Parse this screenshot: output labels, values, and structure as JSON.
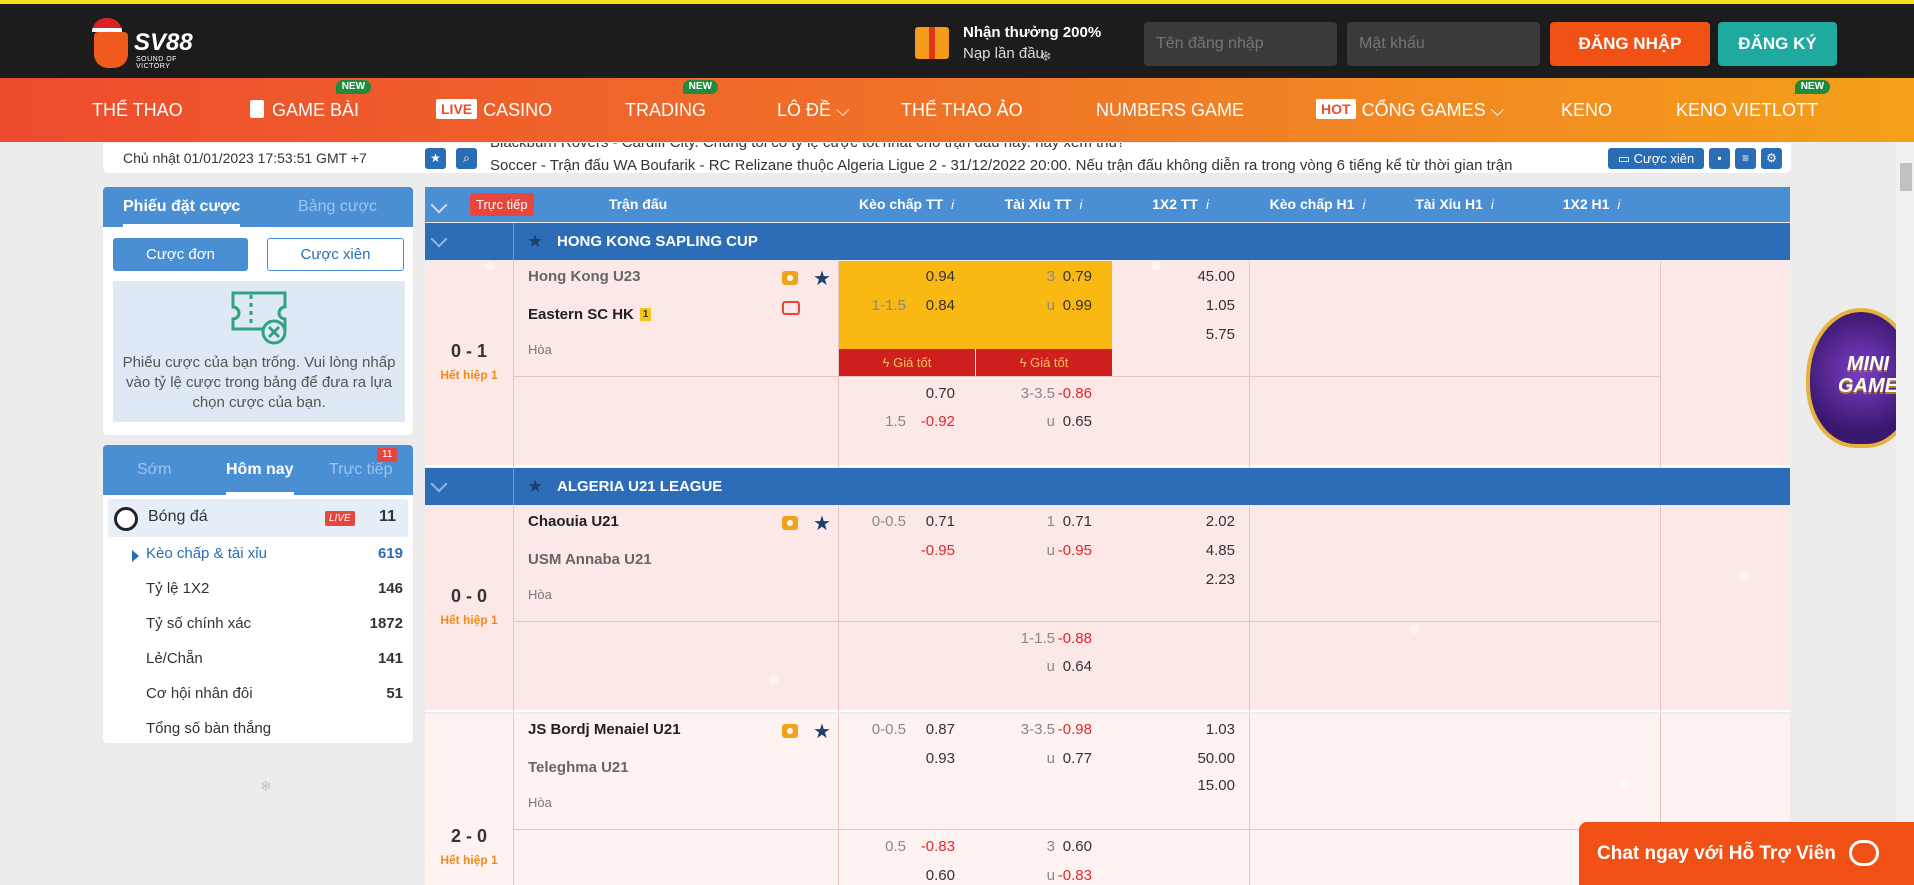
{
  "header": {
    "logo_text": "SV88",
    "logo_sub": "SOUND OF VICTORY",
    "promo_title": "Nhận thưởng 200%",
    "promo_sub": "Nạp lần đầu",
    "username_placeholder": "Tên đăng nhập",
    "password_placeholder": "Mật khẩu",
    "login_label": "ĐĂNG NHẬP",
    "register_label": "ĐĂNG KÝ"
  },
  "nav": [
    {
      "label": "THỂ THAO"
    },
    {
      "label": "GAME BÀI",
      "badge": "NEW"
    },
    {
      "tag": "LIVE",
      "label": "CASINO"
    },
    {
      "label": "TRADING",
      "badge": "NEW"
    },
    {
      "label": "LÔ ĐỀ"
    },
    {
      "label": "THỂ THAO ẢO"
    },
    {
      "label": "NUMBERS GAME"
    },
    {
      "tag": "HOT",
      "label": "CỔNG GAMES"
    },
    {
      "label": "KENO"
    },
    {
      "label": "KENO VIETLOTT",
      "badge": "NEW"
    }
  ],
  "ticker": {
    "clock": "Chủ nhật 01/01/2023 17:53:51 GMT +7",
    "line1": "Blackburn Rovers - Cardiff City. Chúng tôi có tỷ lệ cược tốt nhất cho trận đấu này. hãy xem thử!",
    "line2": "Soccer - Trận đấu WA Boufarik - RC Relizane thuộc Algeria Ligue 2 - 31/12/2022 20:00. Nếu trận đấu không diễn ra trong vòng 6 tiếng kể từ thời gian trận",
    "parlay_label": "Cược xiên"
  },
  "betslip": {
    "tab_active": "Phiếu đặt cược",
    "tab_other": "Bảng cược",
    "single_label": "Cược đơn",
    "parlay_label": "Cược xiên",
    "empty_text": "Phiếu cược của bạn trống. Vui lòng nhấp vào tỷ lệ cược trong bảng để đưa ra lựa chọn cược của bạn."
  },
  "sports": {
    "tabs": [
      "Sớm",
      "Hôm nay",
      "Trực tiếp"
    ],
    "live_count": "11",
    "sport_name": "Bóng đá",
    "live_tag": "LIVE",
    "sport_count": "11",
    "markets": [
      {
        "label": "Kèo chấp & tài xỉu",
        "count": "619"
      },
      {
        "label": "Tỷ lệ 1X2",
        "count": "146"
      },
      {
        "label": "Tỷ số chính xác",
        "count": "1872"
      },
      {
        "label": "Lẻ/Chẵn",
        "count": "141"
      },
      {
        "label": "Cơ hội nhân đôi",
        "count": "51"
      },
      {
        "label": "Tổng số bàn thắng",
        "count": ""
      }
    ]
  },
  "board": {
    "live_tag": "Trực tiếp",
    "columns": [
      "Trận đấu",
      "Kèo chấp TT",
      "Tài Xỉu TT",
      "1X2 TT",
      "Kèo chấp H1",
      "Tài Xỉu H1",
      "1X2 H1"
    ],
    "good_price": "Giá tốt",
    "draw_label": "Hòa",
    "leagues": [
      "HONG KONG SAPLING CUP",
      "ALGERIA U21 LEAGUE"
    ],
    "matches": [
      {
        "score": "0 - 1",
        "status": "Hết hiệp 1",
        "home": "Hong Kong U23",
        "away": "Eastern SC HK",
        "yellow": "1",
        "main": {
          "hdp": "",
          "h1": "0.94",
          "hdp2": "1-1.5",
          "h2": "0.84",
          "ou": "3",
          "o1": "0.79",
          "u": "u",
          "o2": "0.99",
          "x1": "45.00",
          "x2": "1.05",
          "x3": "5.75"
        },
        "alt": {
          "hdp": "",
          "h1": "0.70",
          "hdp2": "1.5",
          "h2": "-0.92",
          "ou": "3-3.5",
          "o1": "-0.86",
          "u": "u",
          "o2": "0.65"
        }
      },
      {
        "score": "0 - 0",
        "status": "Hết hiệp 1",
        "home": "Chaouia U21",
        "away": "USM Annaba U21",
        "main": {
          "hdp": "0-0.5",
          "h1": "0.71",
          "hdp2": "",
          "h2": "-0.95",
          "ou": "1",
          "o1": "0.71",
          "u": "u",
          "o2": "-0.95",
          "x1": "2.02",
          "x2": "4.85",
          "x3": "2.23"
        },
        "alt": {
          "ou": "1-1.5",
          "o1": "-0.88",
          "u": "u",
          "o2": "0.64"
        }
      },
      {
        "score": "2 - 0",
        "status": "Hết hiệp 1",
        "home": "JS Bordj Menaiel U21",
        "away": "Teleghma U21",
        "main": {
          "hdp": "0-0.5",
          "h1": "0.87",
          "hdp2": "",
          "h2": "0.93",
          "ou": "3-3.5",
          "o1": "-0.98",
          "u": "u",
          "o2": "0.77",
          "x1": "1.03",
          "x2": "50.00",
          "x3": "15.00"
        },
        "alt": {
          "hdp": "0.5",
          "h1": "-0.83",
          "h2": "0.60",
          "ou": "3",
          "o1": "0.60",
          "u": "u",
          "o2": "-0.83"
        }
      }
    ]
  },
  "mini_game": "MINI GAME",
  "chat_label": "Chat ngay với Hỗ Trợ Viên"
}
